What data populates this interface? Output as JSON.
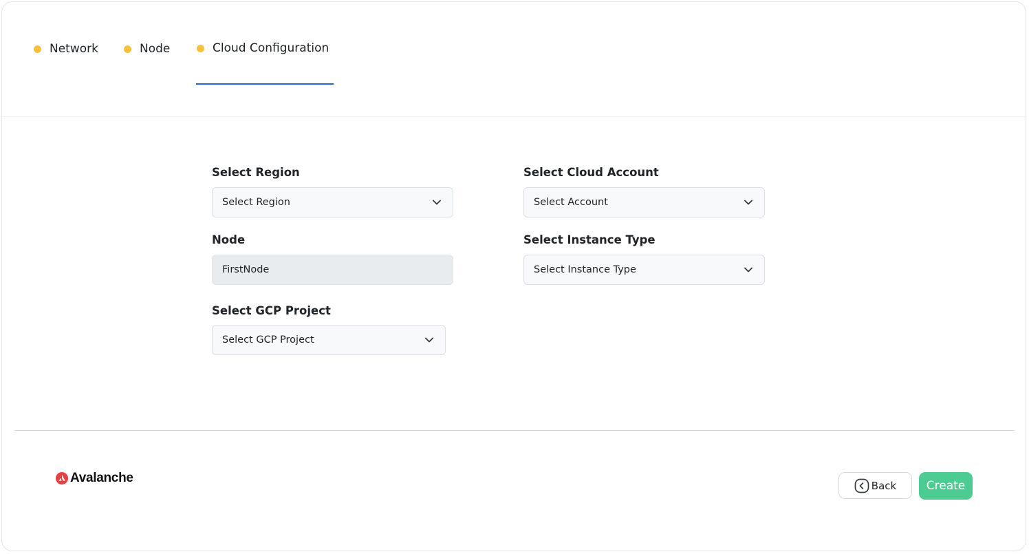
{
  "tabs": [
    {
      "label": "Network"
    },
    {
      "label": "Node"
    },
    {
      "label": "Cloud Configuration",
      "active": true
    }
  ],
  "form": {
    "region": {
      "label": "Select Region",
      "value": "Select Region"
    },
    "cloud_account": {
      "label": "Select Cloud Account",
      "value": "Select Account"
    },
    "node": {
      "label": "Node",
      "value": "FirstNode"
    },
    "instance_type": {
      "label": "Select Instance Type",
      "value": "Select Instance Type"
    },
    "gcp_project": {
      "label": "Select GCP Project",
      "value": "Select GCP Project"
    }
  },
  "footer": {
    "brand": "Avalanche",
    "back_label": "Back",
    "create_label": "Create"
  },
  "colors": {
    "tab_dot": "#f7c13f",
    "active_underline": "#2563d8",
    "create_button": "#4ccb93",
    "brand_red": "#e84142"
  },
  "icons": [
    "chevron-down-icon",
    "back-circle-icon",
    "avalanche-logo-icon"
  ]
}
